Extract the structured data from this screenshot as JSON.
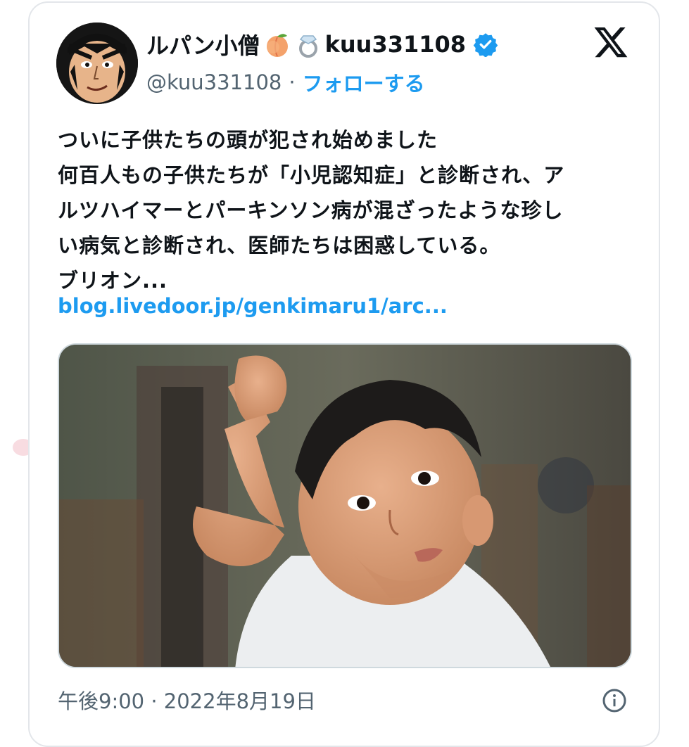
{
  "author": {
    "display_name": "ルパン小僧",
    "name_suffix": "kuu331108",
    "handle": "@kuu331108",
    "separator": "·",
    "follow_label": "フォローする",
    "peach_icon": "peach-emoji-icon",
    "ring_icon": "ring-emoji-icon",
    "verified_icon": "verified-badge-icon",
    "avatar_icon": "cartoon-avatar"
  },
  "platform": {
    "logo_icon": "x-logo-icon"
  },
  "tweet": {
    "lines": [
      "ついに子供たちの頭が犯され始めました",
      "何百人もの子供たちが「小児認知症」と診断され、ア",
      "ルツハイマーとパーキンソン病が混ざったような珍し",
      "い病気と診断され、医師たちは困惑している。",
      "ブリオン..."
    ],
    "link": "blog.livedoor.jp/genkimaru1/arc..."
  },
  "media": {
    "description_icon": "photo-child-scratching-head"
  },
  "footer": {
    "timestamp": "午後9:00 · 2022年8月19日",
    "info_icon": "info-icon"
  },
  "colors": {
    "accent": "#1d9bf0",
    "text": "#0f1419",
    "secondary": "#536471",
    "border": "#e3e6ea"
  }
}
